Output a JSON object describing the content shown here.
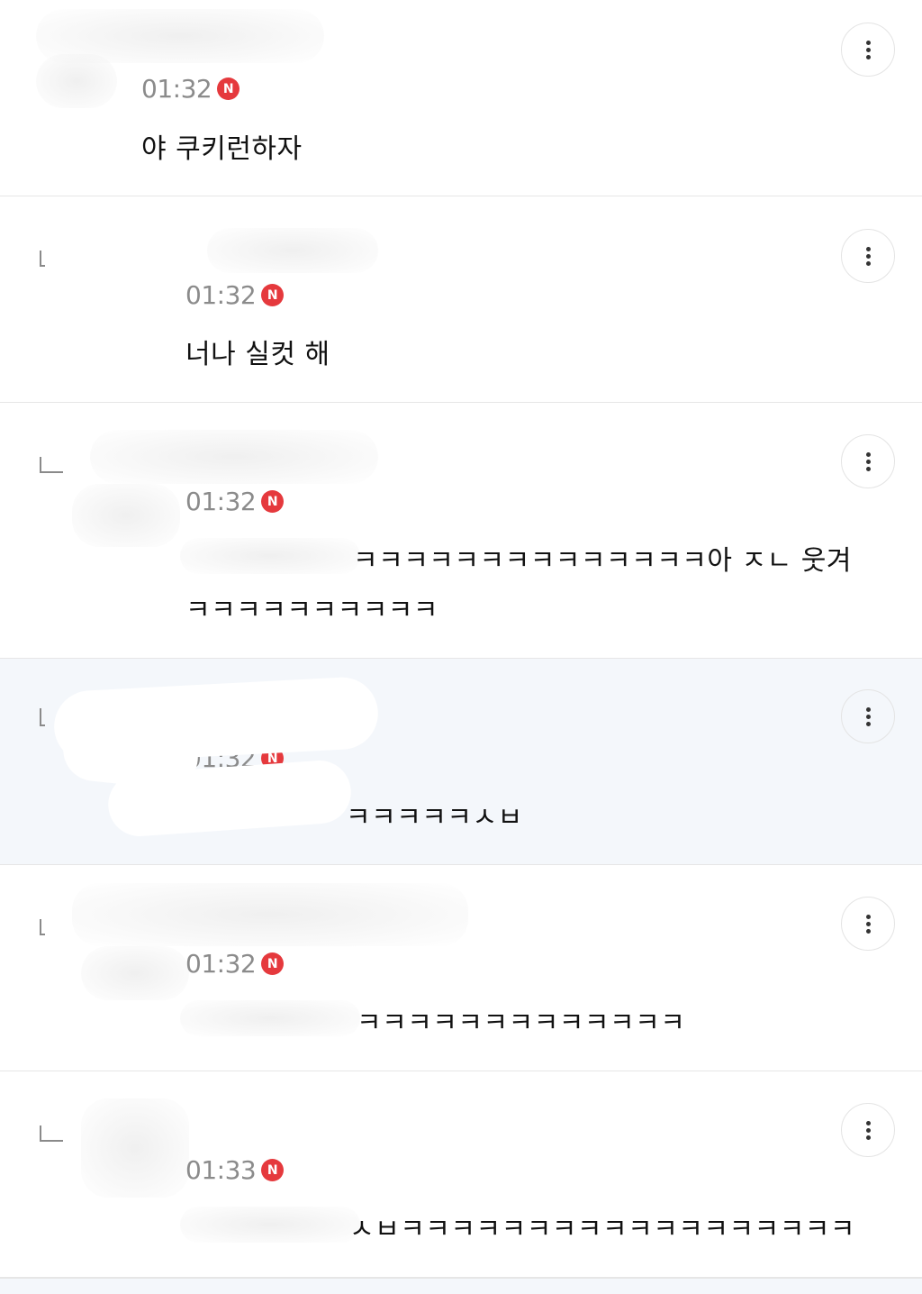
{
  "comments": [
    {
      "time": "01:32",
      "badge": "N",
      "text": "야 쿠키런하자",
      "text2": ""
    },
    {
      "time": "01:32",
      "badge": "N",
      "text": "너나 실컷 해",
      "text2": ""
    },
    {
      "time": "01:32",
      "badge": "N",
      "text": "ㅋㅋㅋㅋㅋㅋㅋㅋㅋㅋㅋㅋㅋㅋ아 ㅈㄴ 웃겨",
      "text2": "ㅋㅋㅋㅋㅋㅋㅋㅋㅋㅋ"
    },
    {
      "time": "01:32",
      "badge": "N",
      "text": "ㅋㅋㅋㅋㅋㅅㅂ",
      "text2": ""
    },
    {
      "time": "01:32",
      "badge": "N",
      "text": "ㅋㅋㅋㅋㅋㅋㅋㅋㅋㅋㅋㅋㅋ",
      "text2": ""
    },
    {
      "time": "01:33",
      "badge": "N",
      "text": "ㅅㅂㅋㅋㅋㅋㅋㅋㅋㅋㅋㅋㅋㅋㅋㅋㅋㅋㅋㅋ",
      "text2": ""
    }
  ],
  "more_icon": "more-vertical-icon",
  "colors": {
    "badge": "#e5393d",
    "highlight_bg": "#f4f7fb",
    "time": "#8b8b8b"
  }
}
